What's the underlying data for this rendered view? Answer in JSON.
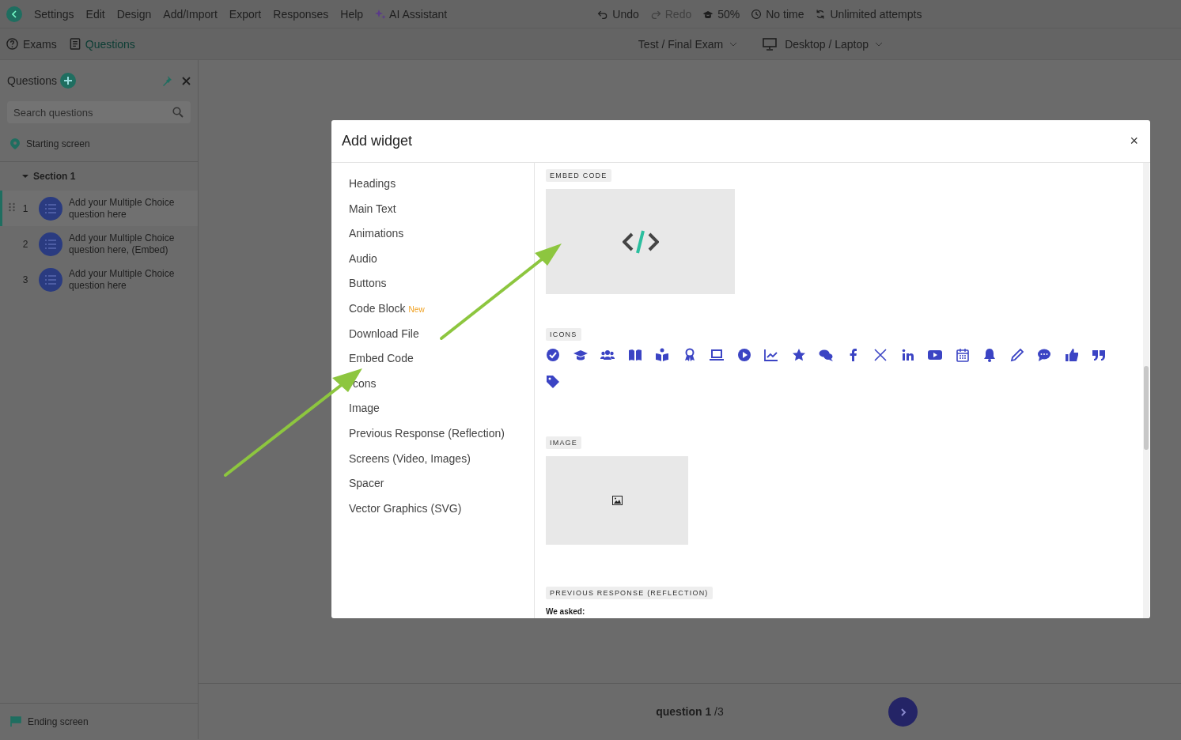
{
  "menu": {
    "items": [
      "Settings",
      "Edit",
      "Design",
      "Add/Import",
      "Export",
      "Responses",
      "Help"
    ],
    "ai_assistant": "AI Assistant"
  },
  "toolbar": [
    {
      "kind": "undo",
      "label": "Undo",
      "disabled": false
    },
    {
      "kind": "redo",
      "label": "Redo",
      "disabled": true
    },
    {
      "kind": "score",
      "label": "50%",
      "disabled": false
    },
    {
      "kind": "time",
      "label": "No time",
      "disabled": false
    },
    {
      "kind": "attempts",
      "label": "Unlimited attempts",
      "disabled": false
    }
  ],
  "tabs": [
    {
      "kind": "help",
      "label": "Exams",
      "selected": false
    },
    {
      "kind": "doc",
      "label": "Questions",
      "selected": true
    }
  ],
  "exam_select": "Test / Final Exam",
  "device_select": "Desktop / Laptop",
  "sidebar": {
    "title": "Questions",
    "search": {
      "placeholder": "Search questions"
    },
    "starting": "Starting screen",
    "section": {
      "label": "Section 1",
      "expanded": true,
      "questions": [
        {
          "number": "1",
          "text": "Add your Multiple Choice question here",
          "selected": true
        },
        {
          "number": "2",
          "text": "Add your Multiple Choice question here, (Embed)",
          "selected": false
        },
        {
          "number": "3",
          "text": "Add your Multiple Choice question here",
          "selected": false
        }
      ]
    },
    "ending": "Ending screen"
  },
  "footer": {
    "current": "question 1",
    "total": "/3"
  },
  "modal": {
    "title": "Add widget",
    "close": "×",
    "categories": [
      {
        "label": "Headings"
      },
      {
        "label": "Main Text"
      },
      {
        "label": "Animations"
      },
      {
        "label": "Audio"
      },
      {
        "label": "Buttons"
      },
      {
        "label": "Code Block",
        "badge": "New"
      },
      {
        "label": "Download File"
      },
      {
        "label": "Embed Code"
      },
      {
        "label": "cons",
        "covered": true
      },
      {
        "label": "Image"
      },
      {
        "label": "Previous Response (Reflection)"
      },
      {
        "label": "Screens (Video, Images)"
      },
      {
        "label": "Spacer"
      },
      {
        "label": "Vector Graphics (SVG)"
      }
    ],
    "sections": [
      {
        "kind": "embed",
        "label": "EMBED CODE"
      },
      {
        "kind": "icons",
        "label": "ICONS"
      },
      {
        "kind": "image",
        "label": "IMAGE"
      },
      {
        "kind": "reflection",
        "label": "PREVIOUS RESPONSE (REFLECTION)",
        "heading": "We asked:"
      }
    ]
  }
}
